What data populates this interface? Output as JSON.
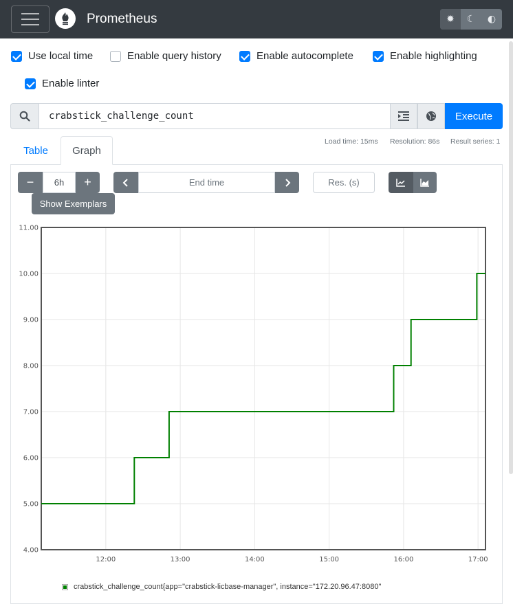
{
  "navbar": {
    "brand": "Prometheus",
    "theme_buttons": [
      {
        "name": "light",
        "icon": "sun-icon"
      },
      {
        "name": "dark",
        "icon": "moon-icon"
      },
      {
        "name": "auto",
        "icon": "adjust-icon"
      }
    ],
    "theme_selected": "light"
  },
  "options": [
    {
      "label": "Use local time",
      "checked": true
    },
    {
      "label": "Enable query history",
      "checked": false
    },
    {
      "label": "Enable autocomplete",
      "checked": true
    },
    {
      "label": "Enable highlighting",
      "checked": true
    },
    {
      "label": "Enable linter",
      "checked": true
    }
  ],
  "query": {
    "expression": "crabstick_challenge_count",
    "execute_label": "Execute"
  },
  "tabs": [
    {
      "label": "Table",
      "active": false
    },
    {
      "label": "Graph",
      "active": true
    }
  ],
  "stats": {
    "load_time": "Load time: 15ms",
    "resolution": "Resolution: 86s",
    "result_series": "Result series: 1"
  },
  "graph_controls": {
    "range_minus": "−",
    "range_value": "6h",
    "range_plus": "+",
    "end_time_placeholder": "End time",
    "resolution_placeholder": "Res. (s)",
    "show_exemplars": "Show Exemplars"
  },
  "colors": {
    "series": "#008000",
    "primary": "#007bff",
    "navbar": "#343a40"
  },
  "chart_data": {
    "type": "line",
    "x_ticks": [
      "12:00",
      "13:00",
      "14:00",
      "15:00",
      "16:00",
      "17:00"
    ],
    "y_ticks": [
      "4.00",
      "5.00",
      "6.00",
      "7.00",
      "8.00",
      "9.00",
      "10.00",
      "11.00"
    ],
    "ylim": [
      4,
      11
    ],
    "grid": true,
    "series": [
      {
        "name": "crabstick_challenge_count{app=\"crabstick-licbase-manager\", instance=\"172.20.96.47:8080\"",
        "points": [
          [
            "11:08",
            5
          ],
          [
            "12:23",
            5
          ],
          [
            "12:23",
            6
          ],
          [
            "12:51",
            6
          ],
          [
            "12:51",
            7
          ],
          [
            "15:52",
            7
          ],
          [
            "15:52",
            8
          ],
          [
            "16:06",
            8
          ],
          [
            "16:06",
            9
          ],
          [
            "16:59",
            9
          ],
          [
            "16:59",
            10
          ],
          [
            "17:06",
            10
          ]
        ]
      }
    ],
    "legend_position": "bottom"
  }
}
